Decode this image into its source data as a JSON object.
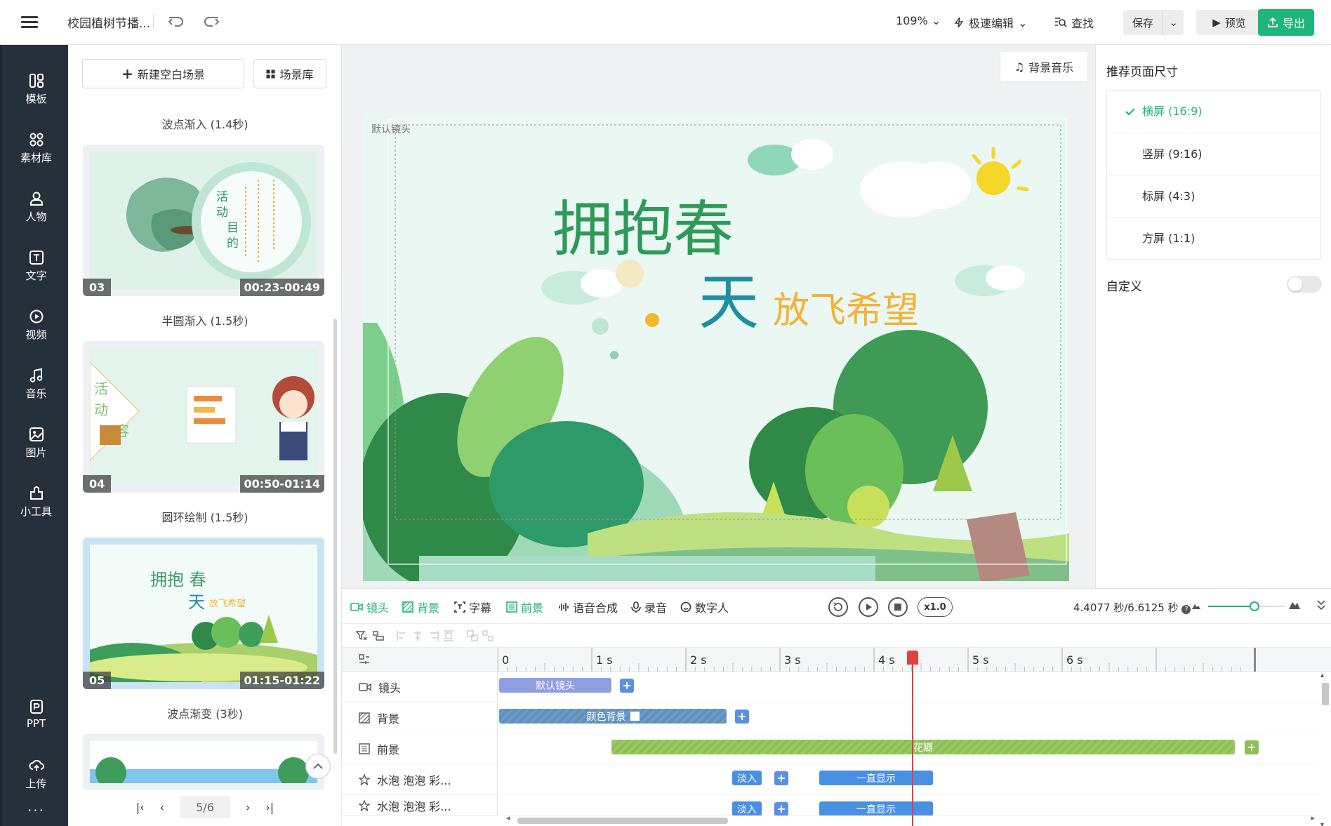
{
  "header": {
    "doc_title": "校园植树节播...",
    "zoom": "109%",
    "edit_mode": "极速编辑",
    "find_label": "查找",
    "save_label": "保存",
    "preview_label": "预览",
    "export_label": "导出"
  },
  "sidebar": {
    "items": [
      {
        "label": "模板",
        "icon": "template-icon"
      },
      {
        "label": "素材库",
        "icon": "assets-icon"
      },
      {
        "label": "人物",
        "icon": "person-icon"
      },
      {
        "label": "文字",
        "icon": "text-icon"
      },
      {
        "label": "视频",
        "icon": "video-icon"
      },
      {
        "label": "音乐",
        "icon": "music-icon"
      },
      {
        "label": "图片",
        "icon": "image-icon"
      },
      {
        "label": "小工具",
        "icon": "tools-icon"
      }
    ],
    "bottom_items": [
      {
        "label": "PPT",
        "icon": "ppt-icon"
      },
      {
        "label": "上传",
        "icon": "upload-icon"
      }
    ],
    "more": "···"
  },
  "scenes": {
    "new_scene_label": "新建空白场景",
    "library_label": "场景库",
    "items": [
      {
        "transition": "波点渐入 (1.4秒)",
        "num": "03",
        "time": "00:23-00:49",
        "thumb_text": [
          "活",
          "动",
          "目",
          "的"
        ]
      },
      {
        "transition": "半圆渐入 (1.5秒)",
        "num": "04",
        "time": "00:50-01:14",
        "thumb_text": [
          "活",
          "动",
          "容"
        ]
      },
      {
        "transition": "圆环绘制 (1.5秒)",
        "num": "05",
        "time": "01:15-01:22",
        "thumb_text": [
          "拥抱 春",
          "天",
          "放飞希望"
        ]
      },
      {
        "transition": "波点渐变 (3秒)"
      }
    ],
    "pager": "5/6"
  },
  "canvas": {
    "bgm_label": "背景音乐",
    "lens_label": "默认镜头",
    "title_line1": "拥抱春",
    "title_line2": "天",
    "subtitle": "放飞希望"
  },
  "right_panel": {
    "title": "推荐页面尺寸",
    "sizes": [
      "横屏 (16:9)",
      "竖屏 (9:16)",
      "标屏 (4:3)",
      "方屏 (1:1)"
    ],
    "selected_index": 0,
    "custom_label": "自定义",
    "custom_enabled": false
  },
  "timeline": {
    "tabs": [
      {
        "label": "镜头",
        "icon": "camera-icon",
        "active": true
      },
      {
        "label": "背景",
        "icon": "background-icon",
        "active": true
      },
      {
        "label": "字幕",
        "icon": "subtitle-icon",
        "active": false
      },
      {
        "label": "前景",
        "icon": "foreground-icon",
        "active": true
      },
      {
        "label": "语音合成",
        "icon": "tts-icon",
        "active": false
      },
      {
        "label": "录音",
        "icon": "mic-icon",
        "active": false
      },
      {
        "label": "数字人",
        "icon": "avatar-icon",
        "active": false
      }
    ],
    "speed": "x1.0",
    "time_readout": "4.4077 秒/6.6125 秒",
    "ruler": [
      "0",
      "1 s",
      "2 s",
      "3 s",
      "4 s",
      "5 s",
      "6 s"
    ],
    "playhead_seconds": 4.41,
    "tracks": [
      {
        "name": "镜头",
        "icon": "camera-icon",
        "clips": [
          "默认镜头"
        ]
      },
      {
        "name": "背景",
        "icon": "background-icon",
        "clips": [
          "颜色背景"
        ]
      },
      {
        "name": "前景",
        "icon": "foreground-icon",
        "clips": [
          "花瓣"
        ]
      },
      {
        "name": "水泡 泡泡 彩...",
        "icon": "effect-icon",
        "clips": [
          "淡入",
          "一直显示"
        ]
      },
      {
        "name": "水泡 泡泡 彩...",
        "icon": "effect-icon",
        "clips": [
          "淡入",
          "一直显示"
        ]
      }
    ]
  },
  "colors": {
    "accent": "#1fb57b",
    "sidebar_bg": "#26303b",
    "playhead": "#e04040"
  }
}
